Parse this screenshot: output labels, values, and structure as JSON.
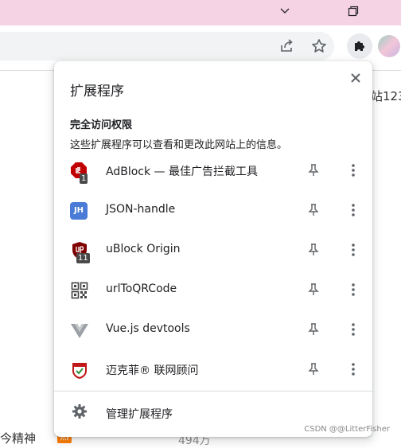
{
  "page": {
    "side_text": "站123",
    "bottom_text": "今精神",
    "hot_badge": "热",
    "bottom_count": "494万",
    "watermark": "CSDN @@LitterFisher"
  },
  "panel": {
    "title": "扩展程序",
    "section_title": "完全访问权限",
    "section_desc": "这些扩展程序可以查看和更改此网站上的信息。",
    "extensions": [
      {
        "name": "AdBlock — 最佳广告拦截工具",
        "icon": "adblock-icon",
        "badge": "1"
      },
      {
        "name": "JSON-handle",
        "icon": "json-handle-icon",
        "icon_text": "JH"
      },
      {
        "name": "uBlock Origin",
        "icon": "ublock-origin-icon",
        "badge": "11"
      },
      {
        "name": "urlToQRCode",
        "icon": "qr-code-icon"
      },
      {
        "name": "Vue.js devtools",
        "icon": "vue-icon"
      },
      {
        "name": "迈克菲® 联网顾问",
        "icon": "mcafee-icon"
      }
    ],
    "manage_label": "管理扩展程序"
  },
  "colors": {
    "titlebar": "#f6d3e4",
    "adblock": "#c00000",
    "json_handle": "#4a7bd6",
    "ublock": "#800000",
    "vue": "#9aa0a6",
    "mcafee": "#c01818"
  }
}
